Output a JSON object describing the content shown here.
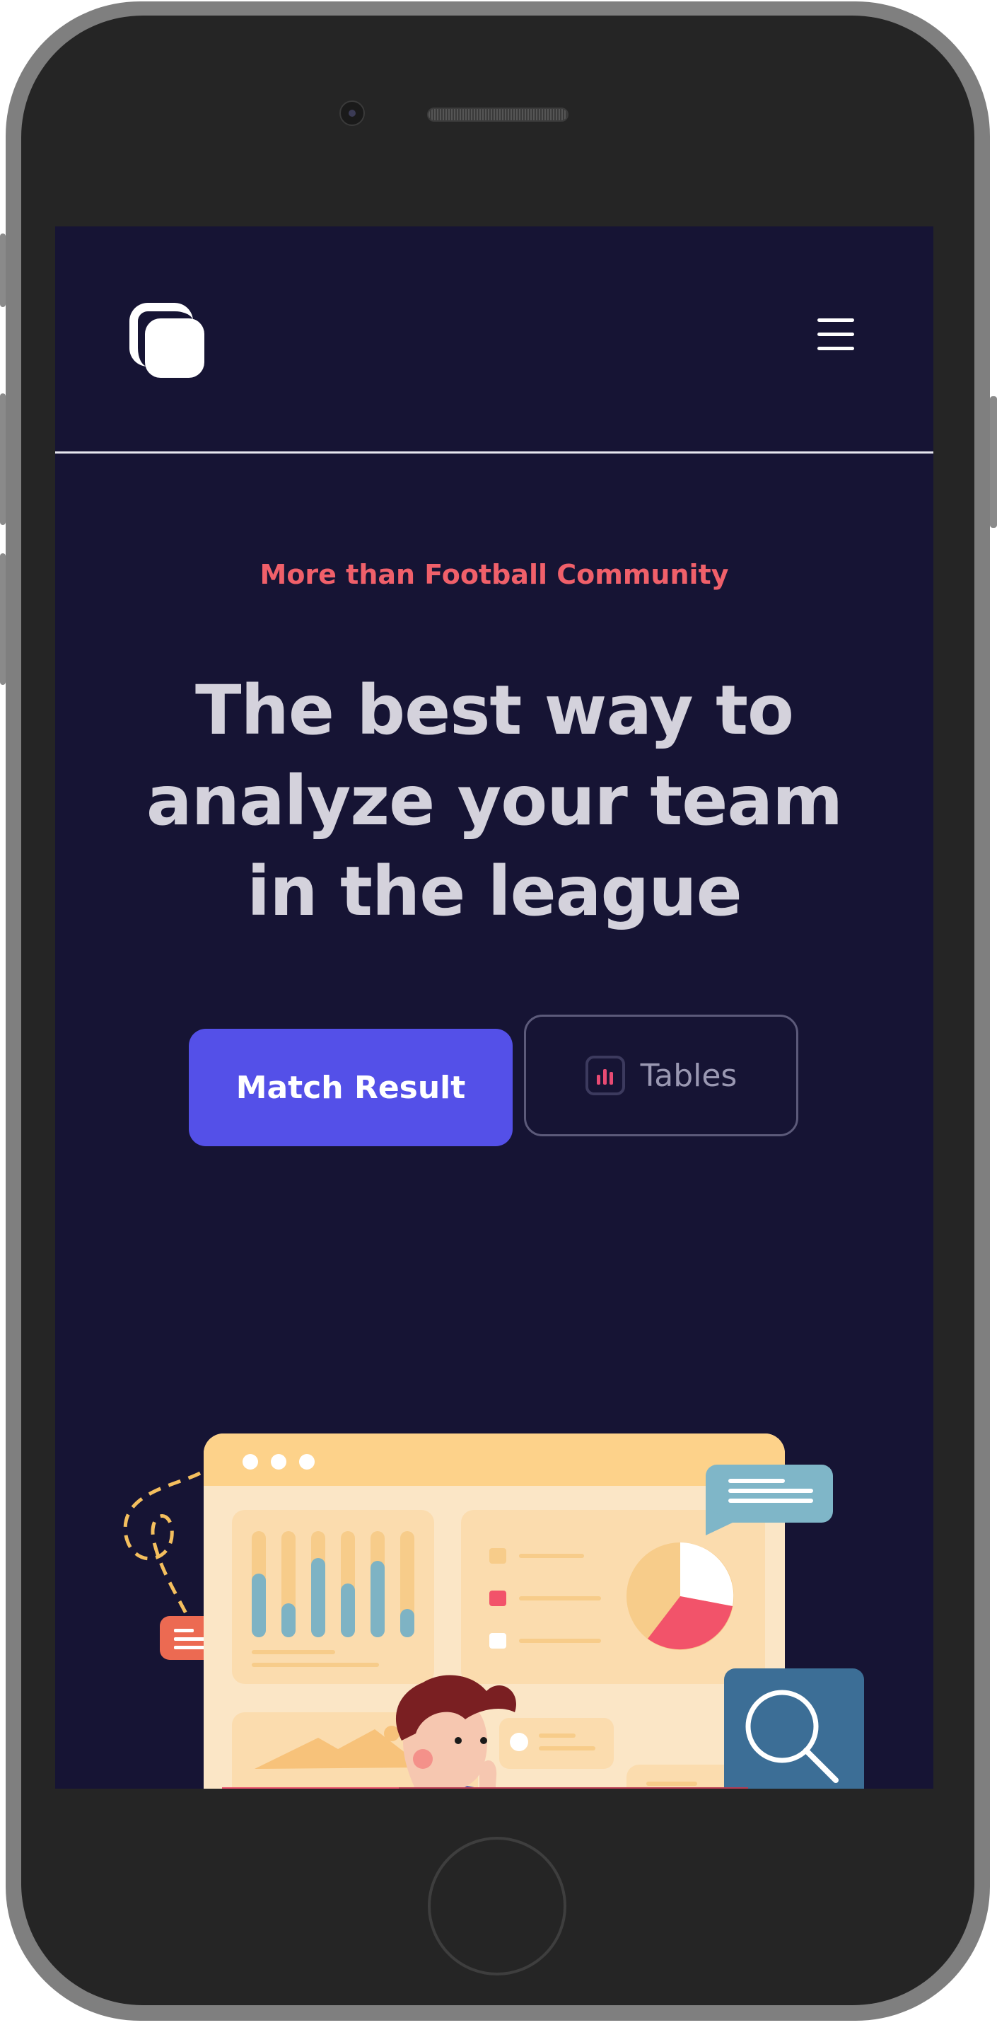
{
  "header": {
    "logo_icon": "stacked-square-logo-icon",
    "menu_icon": "hamburger-menu-icon"
  },
  "hero": {
    "eyebrow": "More than Football Community",
    "headline": "The best way to analyze your team in the league",
    "primary_button": "Match Result",
    "secondary_button": "Tables",
    "secondary_button_icon": "bar-chart-icon"
  },
  "colors": {
    "background": "#161434",
    "accent": "#5450e8",
    "eyebrow": "#f0606a",
    "headline": "#d4d2dc"
  }
}
